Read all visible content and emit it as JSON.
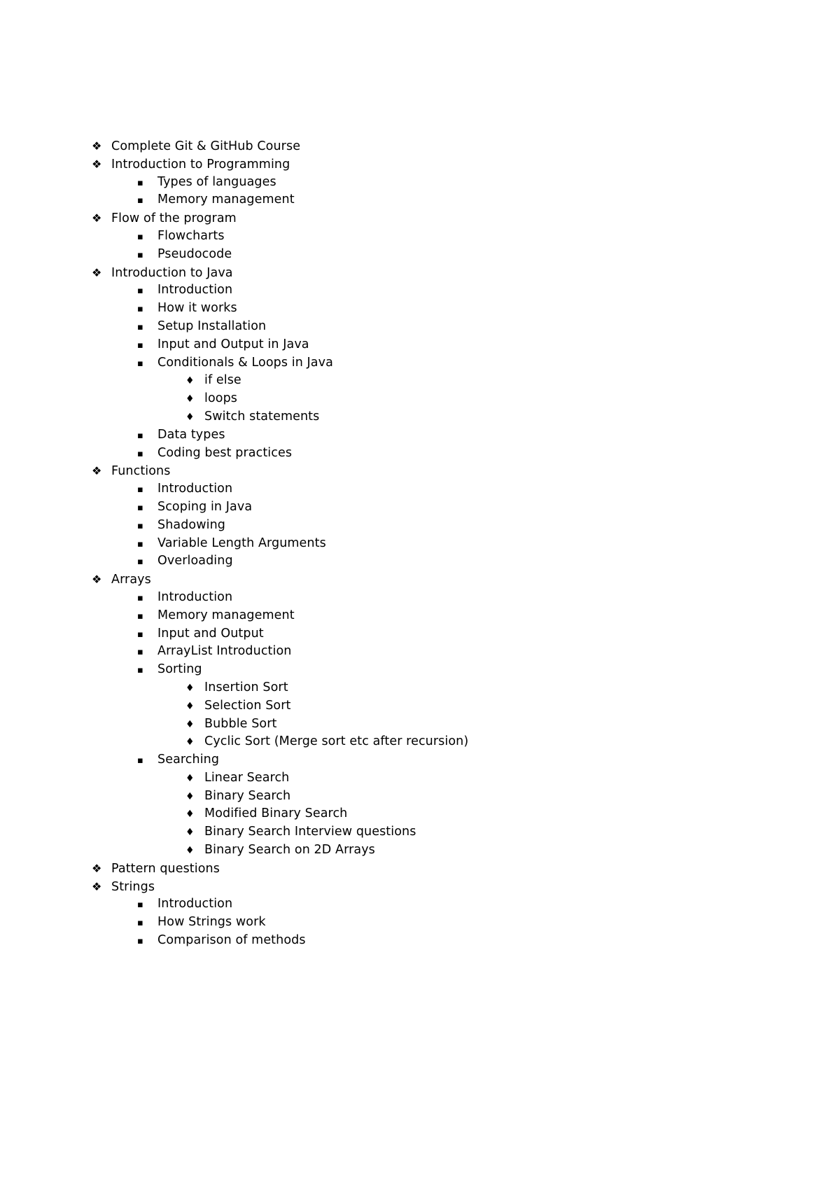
{
  "document": {
    "type": "outline-list",
    "background_color": "#ffffff",
    "text_color": "#000000",
    "bullets": {
      "level1": "❖",
      "level2": "▪",
      "level3": "♦"
    },
    "items": [
      {
        "level": 1,
        "text": "Complete Git & GitHub Course"
      },
      {
        "level": 1,
        "text": "Introduction to Programming"
      },
      {
        "level": 2,
        "text": "Types of languages"
      },
      {
        "level": 2,
        "text": "Memory management"
      },
      {
        "level": 1,
        "text": "Flow of the program"
      },
      {
        "level": 2,
        "text": "Flowcharts"
      },
      {
        "level": 2,
        "text": "Pseudocode"
      },
      {
        "level": 1,
        "text": "Introduction to Java"
      },
      {
        "level": 2,
        "text": "Introduction"
      },
      {
        "level": 2,
        "text": "How it works"
      },
      {
        "level": 2,
        "text": "Setup Installation"
      },
      {
        "level": 2,
        "text": "Input and Output in Java"
      },
      {
        "level": 2,
        "text": "Conditionals & Loops in Java"
      },
      {
        "level": 3,
        "text": "if else"
      },
      {
        "level": 3,
        "text": "loops"
      },
      {
        "level": 3,
        "text": "Switch statements"
      },
      {
        "level": 2,
        "text": "Data types"
      },
      {
        "level": 2,
        "text": "Coding best practices"
      },
      {
        "level": 1,
        "text": "Functions"
      },
      {
        "level": 2,
        "text": "Introduction"
      },
      {
        "level": 2,
        "text": "Scoping in Java"
      },
      {
        "level": 2,
        "text": "Shadowing"
      },
      {
        "level": 2,
        "text": "Variable Length Arguments"
      },
      {
        "level": 2,
        "text": "Overloading"
      },
      {
        "level": 1,
        "text": "Arrays"
      },
      {
        "level": 2,
        "text": "Introduction"
      },
      {
        "level": 2,
        "text": "Memory management"
      },
      {
        "level": 2,
        "text": "Input and Output"
      },
      {
        "level": 2,
        "text": "ArrayList Introduction"
      },
      {
        "level": 2,
        "text": "Sorting"
      },
      {
        "level": 3,
        "text": "Insertion Sort"
      },
      {
        "level": 3,
        "text": "Selection Sort"
      },
      {
        "level": 3,
        "text": "Bubble Sort"
      },
      {
        "level": 3,
        "text": "Cyclic Sort (Merge sort etc after recursion)"
      },
      {
        "level": 2,
        "text": "Searching"
      },
      {
        "level": 3,
        "text": "Linear Search"
      },
      {
        "level": 3,
        "text": "Binary Search"
      },
      {
        "level": 3,
        "text": "Modified Binary Search"
      },
      {
        "level": 3,
        "text": "Binary Search Interview questions"
      },
      {
        "level": 3,
        "text": "Binary Search on 2D Arrays"
      },
      {
        "level": 1,
        "text": "Pattern questions"
      },
      {
        "level": 1,
        "text": "Strings"
      },
      {
        "level": 2,
        "text": "Introduction"
      },
      {
        "level": 2,
        "text": "How Strings work"
      },
      {
        "level": 2,
        "text": "Comparison of methods"
      }
    ]
  }
}
